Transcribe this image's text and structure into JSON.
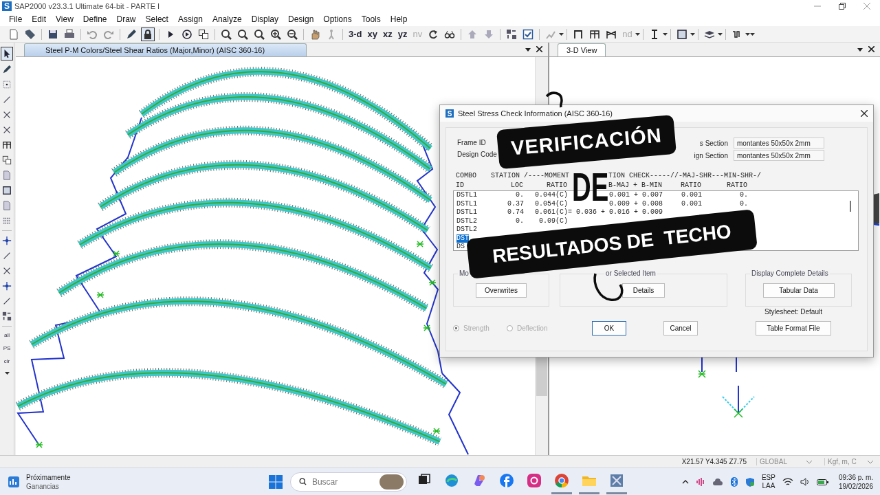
{
  "window": {
    "logo": "S",
    "title": "SAP2000 v23.3.1 Ultimate 64-bit - PARTE I"
  },
  "menu": [
    "File",
    "Edit",
    "View",
    "Define",
    "Draw",
    "Select",
    "Assign",
    "Analyze",
    "Display",
    "Design",
    "Options",
    "Tools",
    "Help"
  ],
  "toolbar": {
    "lock_pressed": true,
    "labels": [
      {
        "text": "3-d",
        "disabled": false
      },
      {
        "text": "xy",
        "disabled": false
      },
      {
        "text": "xz",
        "disabled": false
      },
      {
        "text": "yz",
        "disabled": false
      },
      {
        "text": "nv",
        "disabled": true
      },
      {
        "text": "nd",
        "disabled": true
      }
    ]
  },
  "side_toolbar": {
    "pointer_pressed": true,
    "labels": [
      "all",
      "PS",
      "clr"
    ]
  },
  "panes": [
    {
      "title": "Steel P-M Colors/Steel Shear Ratios (Major,Minor)  (AISC 360-16)",
      "active": true
    },
    {
      "title": "3-D View",
      "active": false
    }
  ],
  "dialog": {
    "logo": "S",
    "title": "Steel Stress Check Information (AISC 360-16)",
    "labels": [
      "Frame ID",
      "Design Code"
    ],
    "section_fields": [
      {
        "label": "s Section",
        "value": "montantes 50x50x 2mm"
      },
      {
        "label": "ign Section",
        "value": "montantes 50x50x 2mm"
      }
    ],
    "header_1": [
      "COMBO",
      "STATION /----MOMENT",
      "TION CHECK-----//-MAJ-SHR---MIN-SHR-/"
    ],
    "header_2": [
      "ID",
      "LOC",
      "RATIO",
      "B-MAJ + B-MIN",
      "RATIO",
      "RATIO"
    ],
    "rows": [
      {
        "cells": [
          "DSTL1",
          "0.",
          "0.044(C)",
          "0.001 + 0.007",
          "0.001",
          "0."
        ],
        "selected": false
      },
      {
        "cells": [
          "DSTL1",
          "0.37",
          "0.054(C)",
          "0.009 + 0.008",
          "0.001",
          "0."
        ],
        "selected": false
      },
      {
        "cells": [
          "DSTL1",
          "0.74",
          "0.061(C)",
          "= 0.036 + 0.016 + 0.009"
        ],
        "selected": false
      },
      {
        "cells": [
          "DSTL2",
          "0.",
          "0.09(C)"
        ],
        "selected": false
      },
      {
        "cells": [
          "DSTL2"
        ],
        "selected": false
      },
      {
        "cells": [
          "DST"
        ],
        "selected": true
      },
      {
        "cells": [
          "DS"
        ],
        "selected": false
      }
    ],
    "groups": [
      {
        "title": "Mo",
        "button": "Overwrites"
      },
      {
        "title": "or Selected Item",
        "button": "Details"
      },
      {
        "title": "Display Complete Details",
        "button": "Tabular Data"
      }
    ],
    "radios": [
      {
        "label": "Strength",
        "selected": true,
        "disabled": true
      },
      {
        "label": "Deflection",
        "selected": false,
        "disabled": true
      }
    ],
    "buttons": [
      {
        "label": "OK",
        "default": true
      },
      {
        "label": "Cancel",
        "default": false
      }
    ],
    "stylesheet": "Stylesheet: Default",
    "table_format_button": "Table Format File"
  },
  "headline": [
    {
      "kind": "banner",
      "text": "VERIFICACIÓN"
    },
    {
      "kind": "plain",
      "text": "DE"
    },
    {
      "kind": "banner",
      "text": "RESULTADOS DE  TECHO"
    }
  ],
  "status_bar": {
    "coordinates": "X21.57  Y4.345  Z7.75",
    "coordinate_system": "GLOBAL",
    "units": "Kgf, m, C"
  },
  "taskbar": {
    "widget": {
      "title": "Próximamente",
      "subtitle": "Ganancias"
    },
    "search": {
      "placeholder": "Buscar"
    },
    "apps": [
      {
        "running": false
      },
      {
        "running": false
      },
      {
        "running": false
      },
      {
        "running": false
      },
      {
        "running": false
      },
      {
        "running": true
      },
      {
        "running": true
      },
      {
        "running": true
      }
    ],
    "language": [
      "ESP",
      "LAA"
    ],
    "time": "09:36 p. m.",
    "date": "19/02/2026"
  }
}
